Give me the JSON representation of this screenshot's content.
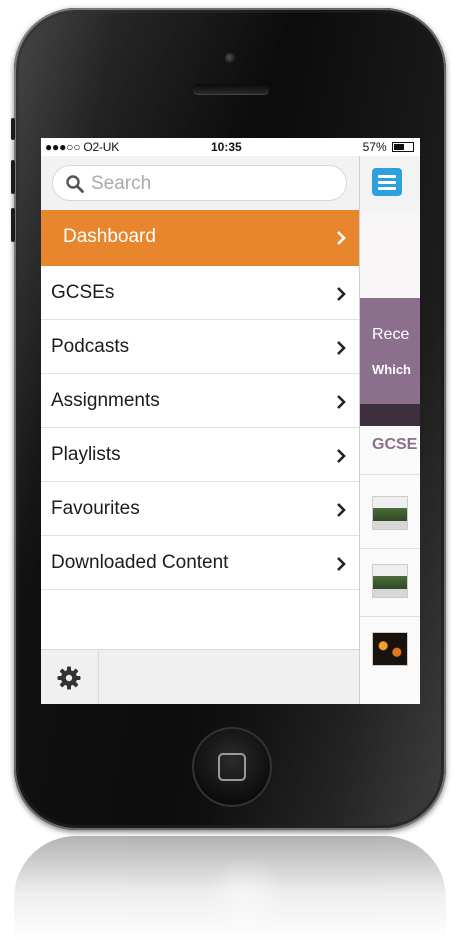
{
  "status_bar": {
    "carrier": "●●●○○ O2-UK",
    "time": "10:35",
    "battery": "57%"
  },
  "search": {
    "placeholder": "Search"
  },
  "menu": {
    "items": [
      {
        "label": "Dashboard",
        "active": true
      },
      {
        "label": "GCSEs",
        "active": false
      },
      {
        "label": "Podcasts",
        "active": false
      },
      {
        "label": "Assignments",
        "active": false
      },
      {
        "label": "Playlists",
        "active": false
      },
      {
        "label": "Favourites",
        "active": false
      },
      {
        "label": "Downloaded Content",
        "active": false
      }
    ]
  },
  "background_app": {
    "recent_title": "Rece",
    "recent_subtitle": "Which",
    "section_label": "GCSE"
  },
  "colors": {
    "accent": "#e8862d",
    "nav_button": "#2ea0e0",
    "recent_banner": "#8b6f8c"
  },
  "icons": {
    "search": "search-icon",
    "chevron": "chevron-right-icon",
    "settings": "gear-icon",
    "menu": "hamburger-icon"
  }
}
